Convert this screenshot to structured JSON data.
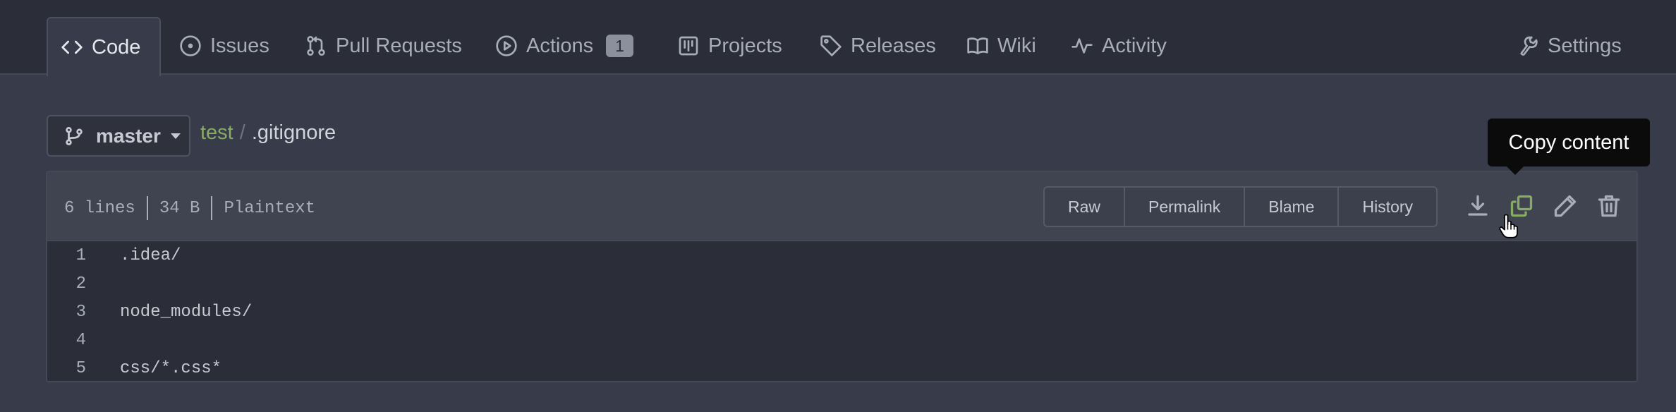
{
  "nav": {
    "tabs": [
      {
        "label": "Code",
        "icon": "code-icon",
        "active": true
      },
      {
        "label": "Issues",
        "icon": "issue-icon"
      },
      {
        "label": "Pull Requests",
        "icon": "pull-request-icon"
      },
      {
        "label": "Actions",
        "icon": "play-icon",
        "badge": "1"
      },
      {
        "label": "Projects",
        "icon": "project-icon"
      },
      {
        "label": "Releases",
        "icon": "tag-icon"
      },
      {
        "label": "Wiki",
        "icon": "book-icon"
      },
      {
        "label": "Activity",
        "icon": "pulse-icon"
      }
    ],
    "settings_label": "Settings"
  },
  "branch": {
    "name": "master"
  },
  "breadcrumb": {
    "repo": "test",
    "separator": "/",
    "file": ".gitignore"
  },
  "file_header": {
    "lines": "6 lines",
    "size": "34 B",
    "language": "Plaintext",
    "buttons": {
      "raw": "Raw",
      "permalink": "Permalink",
      "blame": "Blame",
      "history": "History"
    }
  },
  "tooltip": {
    "text": "Copy content"
  },
  "code": {
    "lines": [
      {
        "number": "1",
        "text": ".idea/"
      },
      {
        "number": "2",
        "text": ""
      },
      {
        "number": "3",
        "text": "node_modules/"
      },
      {
        "number": "4",
        "text": ""
      },
      {
        "number": "5",
        "text": "css/*.css*"
      }
    ]
  },
  "colors": {
    "accent": "#87ab63",
    "background": "#383c4a",
    "header": "#2b2e38"
  }
}
